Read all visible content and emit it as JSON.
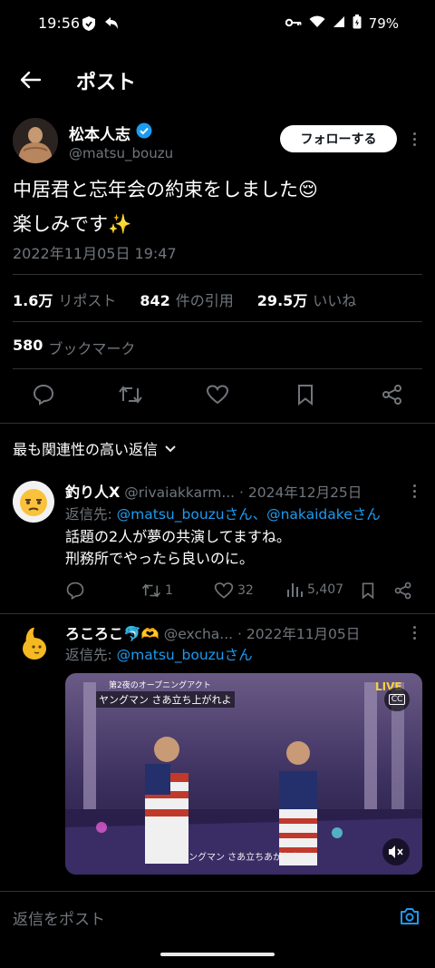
{
  "status_bar": {
    "time": "19:56",
    "battery": "79%"
  },
  "header": {
    "title": "ポスト"
  },
  "post": {
    "author_name": "松本人志",
    "author_handle": "@matsu_bouzu",
    "follow_label": "フォローする",
    "text_line1": "中居君と忘年会の約束をしました😌",
    "text_line2": "楽しみです✨",
    "timestamp": "2022年11月05日 19:47",
    "reposts_count": "1.6万",
    "reposts_label": "リポスト",
    "quotes_count": "842",
    "quotes_label": "件の引用",
    "likes_count": "29.5万",
    "likes_label": "いいね",
    "bookmarks_count": "580",
    "bookmarks_label": "ブックマーク"
  },
  "replies_sort": {
    "label": "最も関連性の高い返信"
  },
  "replies": [
    {
      "name": "釣り人X",
      "handle": "@rivaiakkarm...",
      "date": "· 2024年12月25日",
      "reply_prefix": "返信先:",
      "reply_to": "@matsu_bouzuさん、@nakaidakeさん",
      "text_line1": "話題の2人が夢の共演してますね。",
      "text_line2": "刑務所でやったら良いのに。",
      "retweets": "1",
      "likes": "32",
      "views": "5,407"
    },
    {
      "name": "ろころこ🐬🫶",
      "handle": "@excha...",
      "date": "· 2022年11月05日",
      "reply_prefix": "返信先:",
      "reply_to": "@matsu_bouzuさん",
      "video": {
        "caption_top": "第2夜のオープニングアクト",
        "subtitle_top": "ヤングマン さあ立ち上がれよ",
        "subtitle_bottom": "ヤングマン さあ立ちあがれよ",
        "cc_label": "CC",
        "live_label": "LIVE"
      }
    }
  ],
  "composer": {
    "placeholder": "返信をポスト"
  }
}
